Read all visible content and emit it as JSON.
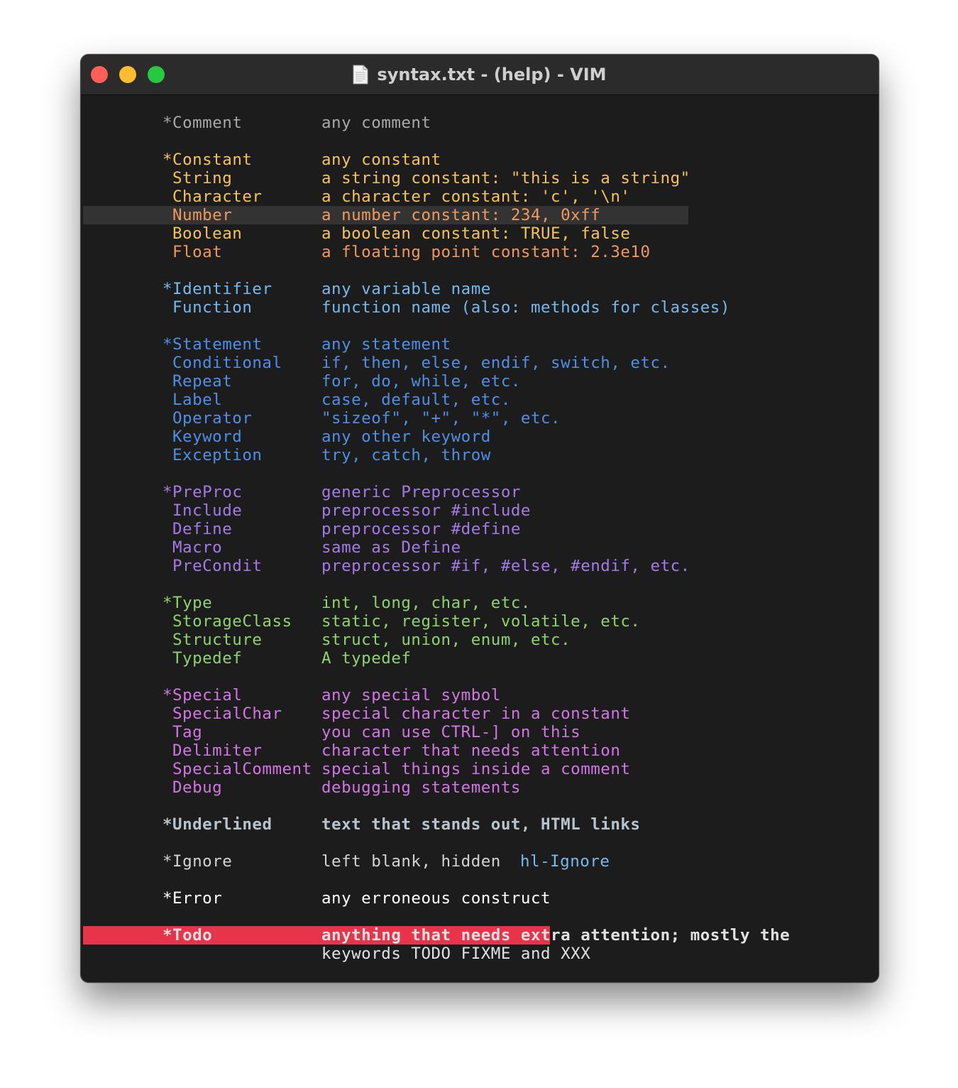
{
  "window": {
    "title": "syntax.txt - (help) - VIM"
  },
  "colors": {
    "comment": "#a9a9a9",
    "constant": "#f6c453",
    "number": "#ef9a5c",
    "identifier": "#76b9ee",
    "statement": "#4f8fe6",
    "preproc": "#a47be6",
    "type": "#8fd46b",
    "special": "#d176e3",
    "error_bg": "#e8344a",
    "cursorline_bg": "#333333"
  },
  "groups": {
    "comment": {
      "name": "*Comment",
      "desc": "any comment"
    },
    "constant": {
      "name": "*Constant",
      "desc": "any constant"
    },
    "string": {
      "name": "String",
      "desc": "a string constant: \"this is a string\""
    },
    "character": {
      "name": "Character",
      "desc": "a character constant: 'c', '\\n'"
    },
    "number": {
      "name": "Number",
      "desc": "a number constant: 234, 0xff"
    },
    "boolean": {
      "name": "Boolean",
      "desc": "a boolean constant: TRUE, false"
    },
    "float": {
      "name": "Float",
      "desc": "a floating point constant: 2.3e10"
    },
    "identifier": {
      "name": "*Identifier",
      "desc": "any variable name"
    },
    "function": {
      "name": "Function",
      "desc": "function name (also: methods for classes)"
    },
    "statement": {
      "name": "*Statement",
      "desc": "any statement"
    },
    "conditional": {
      "name": "Conditional",
      "desc": "if, then, else, endif, switch, etc."
    },
    "repeat": {
      "name": "Repeat",
      "desc": "for, do, while, etc."
    },
    "label": {
      "name": "Label",
      "desc": "case, default, etc."
    },
    "operator": {
      "name": "Operator",
      "desc": "\"sizeof\", \"+\", \"*\", etc."
    },
    "keyword": {
      "name": "Keyword",
      "desc": "any other keyword"
    },
    "exception": {
      "name": "Exception",
      "desc": "try, catch, throw"
    },
    "preproc": {
      "name": "*PreProc",
      "desc": "generic Preprocessor"
    },
    "include": {
      "name": "Include",
      "desc": "preprocessor #include"
    },
    "define": {
      "name": "Define",
      "desc": "preprocessor #define"
    },
    "macro": {
      "name": "Macro",
      "desc": "same as Define"
    },
    "precondit": {
      "name": "PreCondit",
      "desc": "preprocessor #if, #else, #endif, etc."
    },
    "type": {
      "name": "*Type",
      "desc": "int, long, char, etc."
    },
    "storageclass": {
      "name": "StorageClass",
      "desc": "static, register, volatile, etc."
    },
    "structure": {
      "name": "Structure",
      "desc": "struct, union, enum, etc."
    },
    "typedef": {
      "name": "Typedef",
      "desc": "A typedef"
    },
    "special": {
      "name": "*Special",
      "desc": "any special symbol"
    },
    "specialchar": {
      "name": "SpecialChar",
      "desc": "special character in a constant"
    },
    "tag": {
      "name": "Tag",
      "desc": "you can use CTRL-] on this"
    },
    "delimiter": {
      "name": "Delimiter",
      "desc": "character that needs attention"
    },
    "specialcomment": {
      "name": "SpecialComment",
      "desc": "special things inside a comment"
    },
    "debug": {
      "name": "Debug",
      "desc": "debugging statements"
    },
    "underlined": {
      "name": "*Underlined",
      "desc": "text that stands out, HTML links"
    },
    "ignore": {
      "name": "*Ignore",
      "desc": "left blank, hidden",
      "link": "hl-Ignore"
    },
    "error": {
      "name": "*Error",
      "desc": "any erroneous construct"
    },
    "todo": {
      "name": "*Todo",
      "desc": "anything that needs extra attention; mostly the",
      "desc2": "keywords TODO FIXME and XXX"
    }
  }
}
